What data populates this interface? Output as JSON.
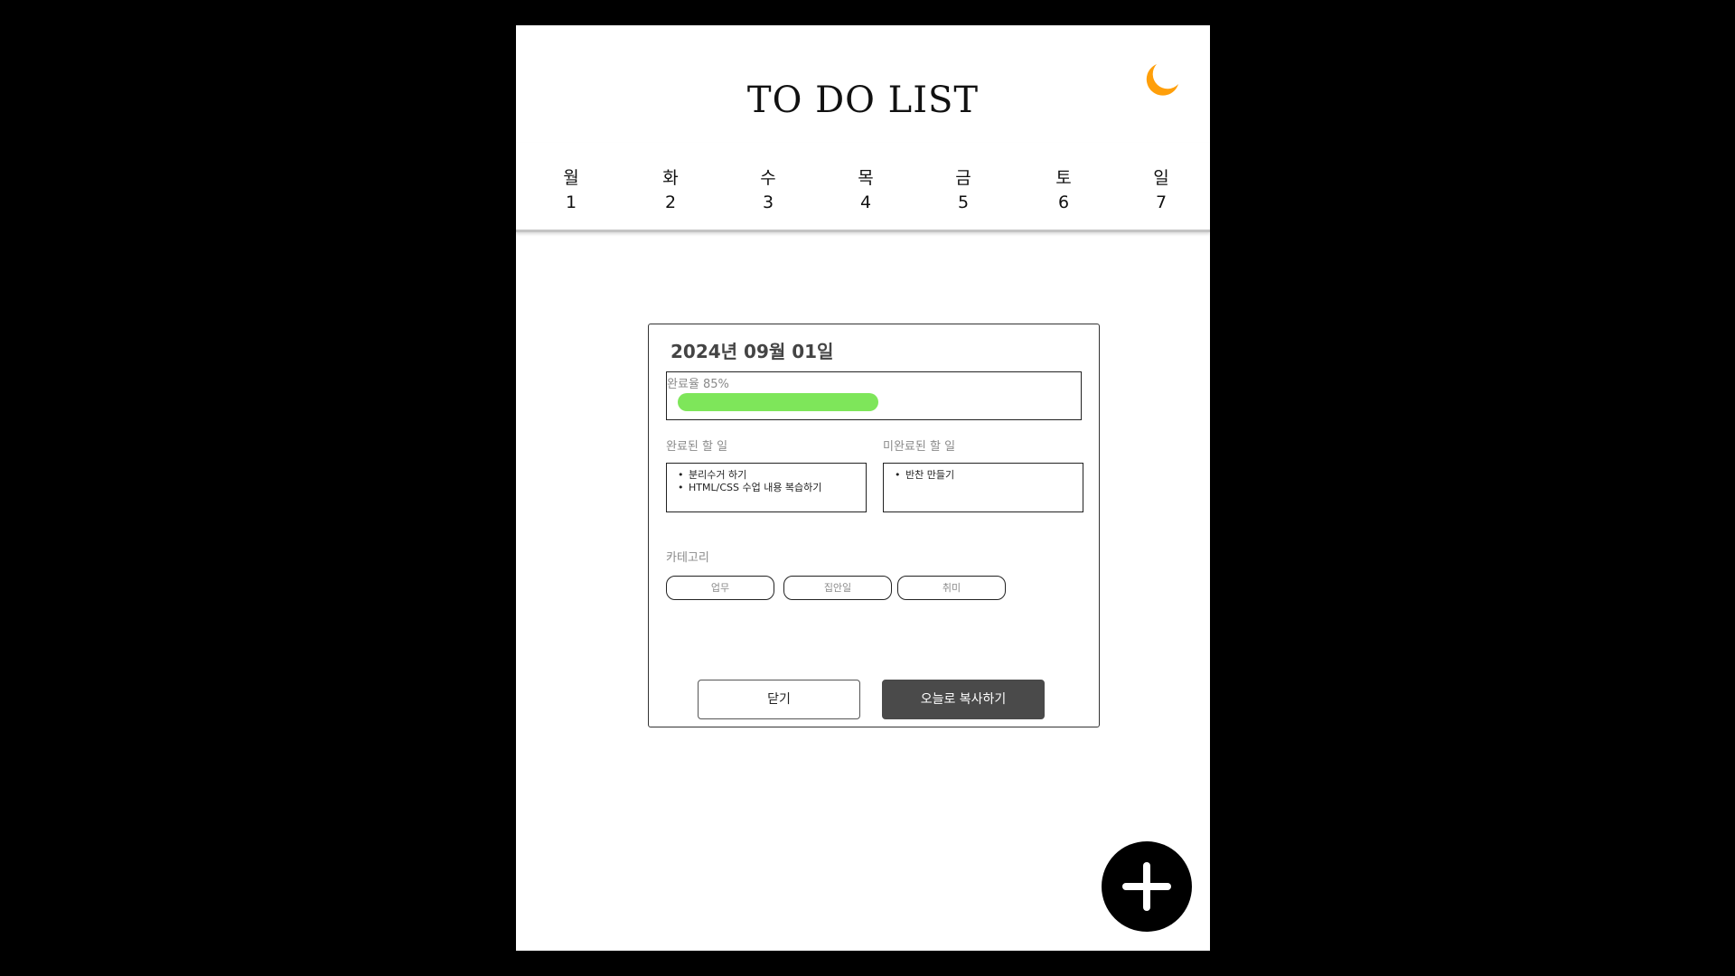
{
  "header": {
    "title": "TO DO LIST",
    "theme_icon": "moon-icon",
    "theme_color": "#FF9F0A"
  },
  "week": [
    {
      "day": "월",
      "date": "1"
    },
    {
      "day": "화",
      "date": "2"
    },
    {
      "day": "수",
      "date": "3"
    },
    {
      "day": "목",
      "date": "4"
    },
    {
      "day": "금",
      "date": "5"
    },
    {
      "day": "토",
      "date": "6"
    },
    {
      "day": "일",
      "date": "7"
    }
  ],
  "modal": {
    "date": "2024년 09월 01일",
    "progress": {
      "label": "완료율 85%",
      "percent": 85,
      "color": "#7EE65A"
    },
    "completed": {
      "label": "완료된 할 일",
      "items": [
        "분리수거 하기",
        "HTML/CSS 수업 내용 복습하기"
      ]
    },
    "incomplete": {
      "label": "미완료된 할 일",
      "items": [
        "반찬 만들기"
      ]
    },
    "category": {
      "label": "카테고리",
      "chips": [
        "업무",
        "집안일",
        "취미"
      ]
    },
    "buttons": {
      "close": "닫기",
      "copy": "오늘로 복사하기"
    }
  },
  "fab": {
    "icon": "plus-icon"
  }
}
